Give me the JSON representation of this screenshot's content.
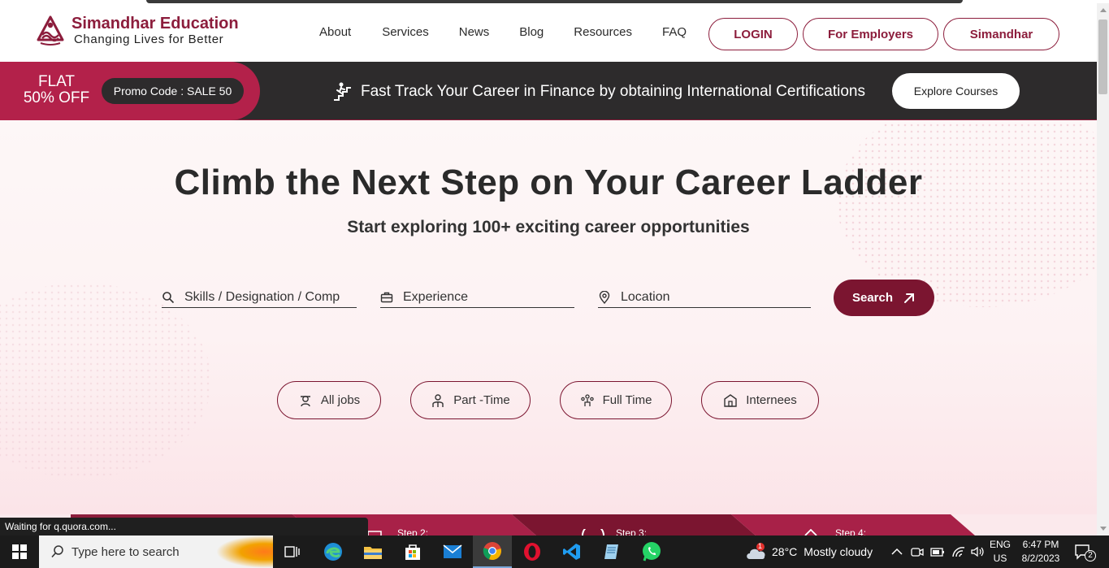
{
  "brand": {
    "title": "Simandhar Education",
    "tagline": "Changing Lives for Better",
    "primary_color": "#8c1d3c"
  },
  "nav": {
    "items": [
      "About",
      "Services",
      "News",
      "Blog",
      "Resources",
      "FAQ"
    ],
    "login_label": "LOGIN",
    "employers_label": "For Employers",
    "simandhar_label": "Simandhar"
  },
  "promo": {
    "flat_line1": "FLAT",
    "flat_line2": "50% OFF",
    "code_label": "Promo Code : SALE 50",
    "message": "Fast Track Your Career in Finance by obtaining International Certifications",
    "explore_label": "Explore Courses"
  },
  "hero": {
    "title": "Climb the Next Step on Your Career Ladder",
    "subtitle": "Start exploring 100+ exciting career opportunities",
    "skills_placeholder": "Skills / Designation / Comp",
    "experience_placeholder": "Experience",
    "location_placeholder": "Location",
    "search_label": "Search"
  },
  "filters": {
    "all_jobs": "All jobs",
    "part_time": "Part -Time",
    "full_time": "Full Time",
    "internees": "Internees"
  },
  "steps": {
    "step2": "Step 2:",
    "step3": "Step 3:",
    "step4": "Step 4:"
  },
  "status_text": "Waiting for q.quora.com...",
  "taskbar": {
    "search_placeholder": "Type here to search",
    "weather_temp": "28°C",
    "weather_desc": "Mostly cloudy",
    "weather_badge": "1",
    "lang_line1": "ENG",
    "lang_line2": "US",
    "time": "6:47 PM",
    "date": "8/2/2023",
    "notifications": "2"
  }
}
